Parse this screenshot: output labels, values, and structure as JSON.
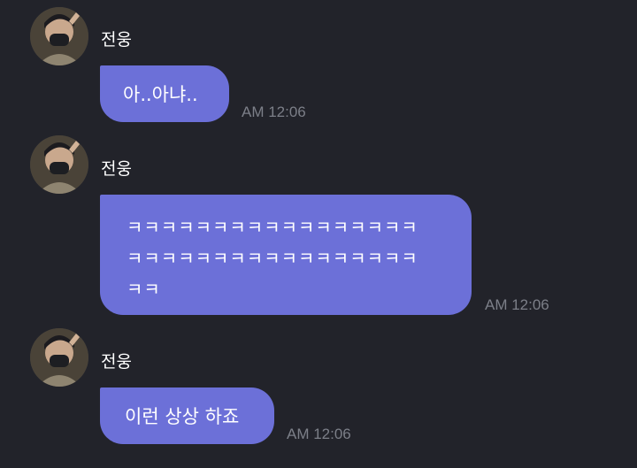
{
  "messages": [
    {
      "sender": "전웅",
      "text": "아..아냐..",
      "time": "AM 12:06"
    },
    {
      "sender": "전웅",
      "text": "ㅋㅋㅋㅋㅋㅋㅋㅋㅋㅋㅋㅋㅋㅋㅋㅋㅋ\nㅋㅋㅋㅋㅋㅋㅋㅋㅋㅋㅋㅋㅋㅋㅋㅋㅋ\nㅋㅋ",
      "time": "AM 12:06"
    },
    {
      "sender": "전웅",
      "text": "이런 상상 하죠",
      "time": "AM 12:06"
    }
  ],
  "colors": {
    "background": "#22232a",
    "bubble": "#6c70d8",
    "time_text": "#7c7f88",
    "sender_text": "#ffffff"
  },
  "icons": {
    "avatar": "profile-photo"
  }
}
